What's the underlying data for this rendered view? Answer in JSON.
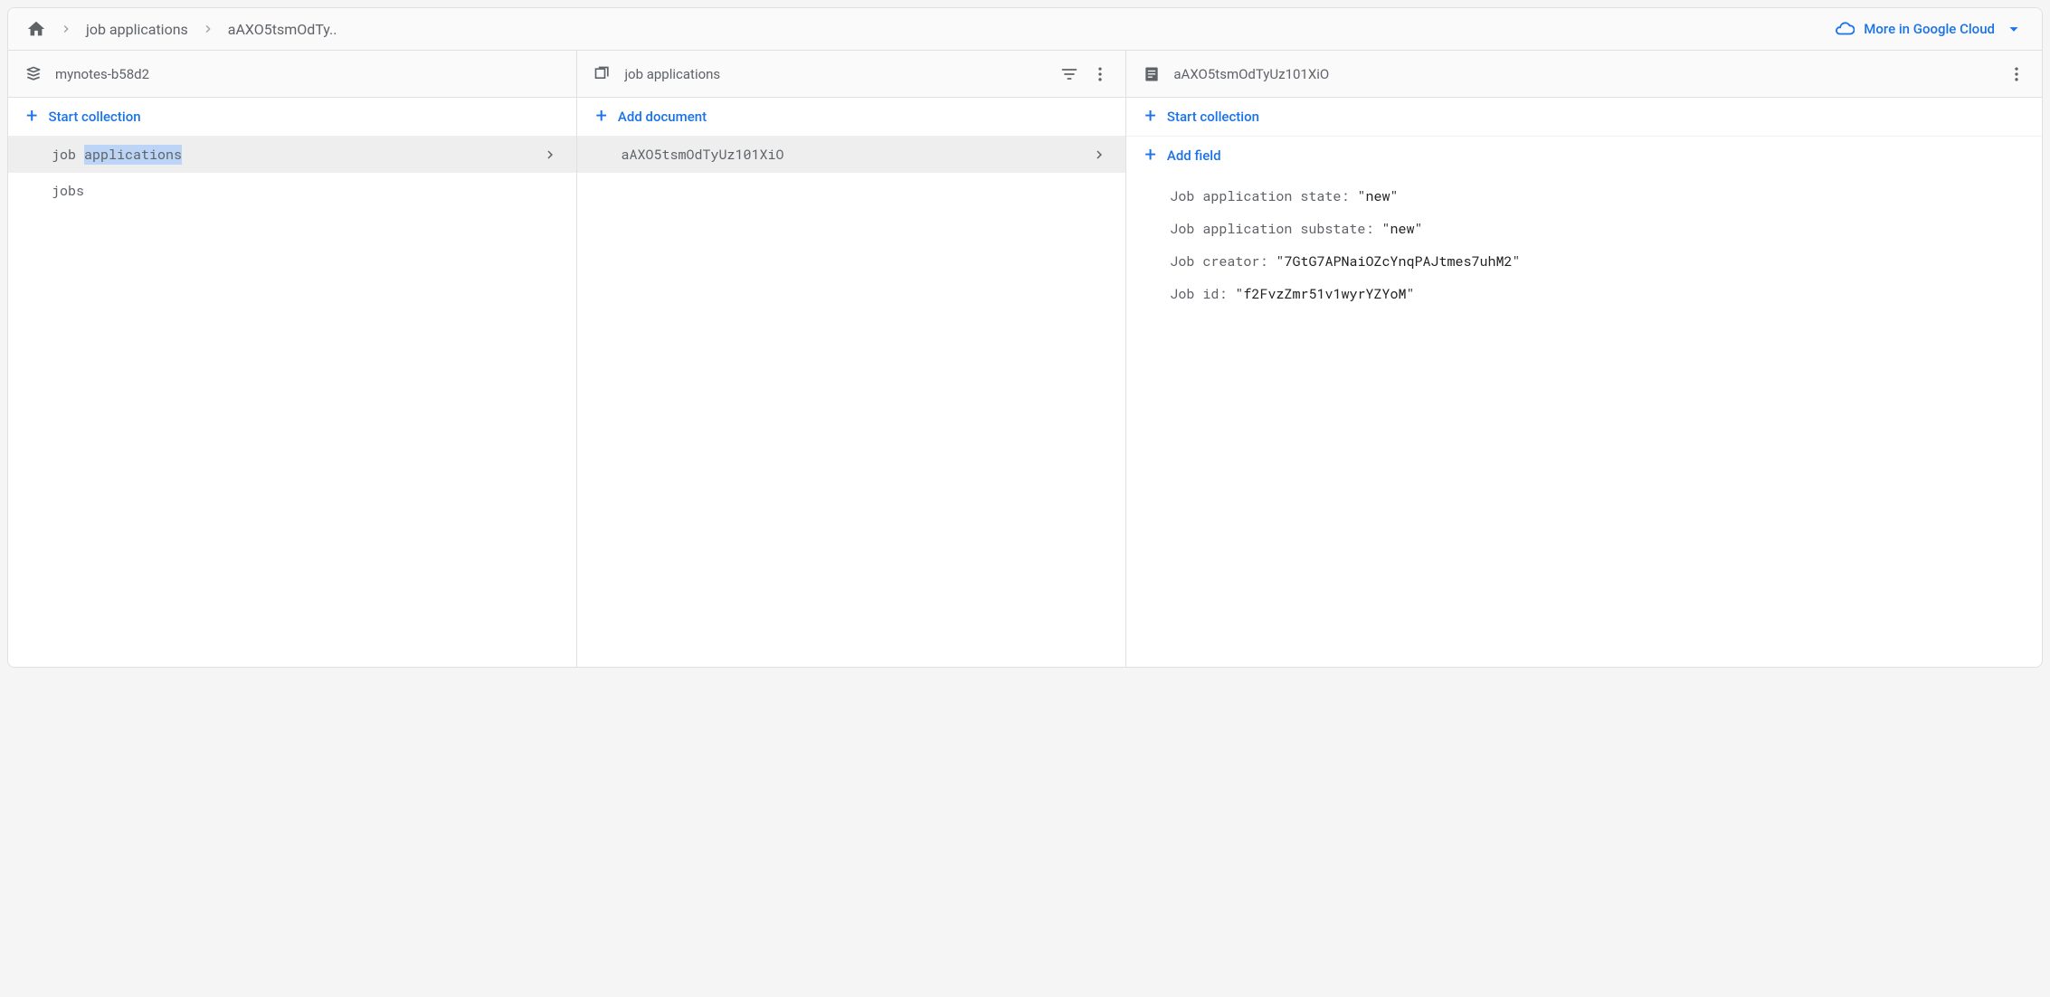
{
  "breadcrumb": {
    "collection": "job applications",
    "document": "aAXO5tsmOdTy.."
  },
  "more_cloud_label": "More in Google Cloud",
  "root": {
    "title": "mynotes-b58d2",
    "start_collection_label": "Start collection",
    "collections": [
      {
        "name_prefix": "job ",
        "name_highlight": "applications",
        "name_suffix": "",
        "selected": true
      },
      {
        "name_prefix": "jobs",
        "name_highlight": "",
        "name_suffix": "",
        "selected": false
      }
    ]
  },
  "collection": {
    "title": "job applications",
    "add_document_label": "Add document",
    "documents": [
      {
        "id": "aAXO5tsmOdTyUz101XiO",
        "selected": true
      }
    ]
  },
  "document": {
    "title": "aAXO5tsmOdTyUz101XiO",
    "start_collection_label": "Start collection",
    "add_field_label": "Add field",
    "fields": [
      {
        "key": "Job application state",
        "value": "new"
      },
      {
        "key": "Job application substate",
        "value": "new"
      },
      {
        "key": "Job creator",
        "value": "7GtG7APNaiOZcYnqPAJtmes7uhM2"
      },
      {
        "key": "Job id",
        "value": "f2FvzZmr51v1wyrYZYoM"
      }
    ]
  }
}
